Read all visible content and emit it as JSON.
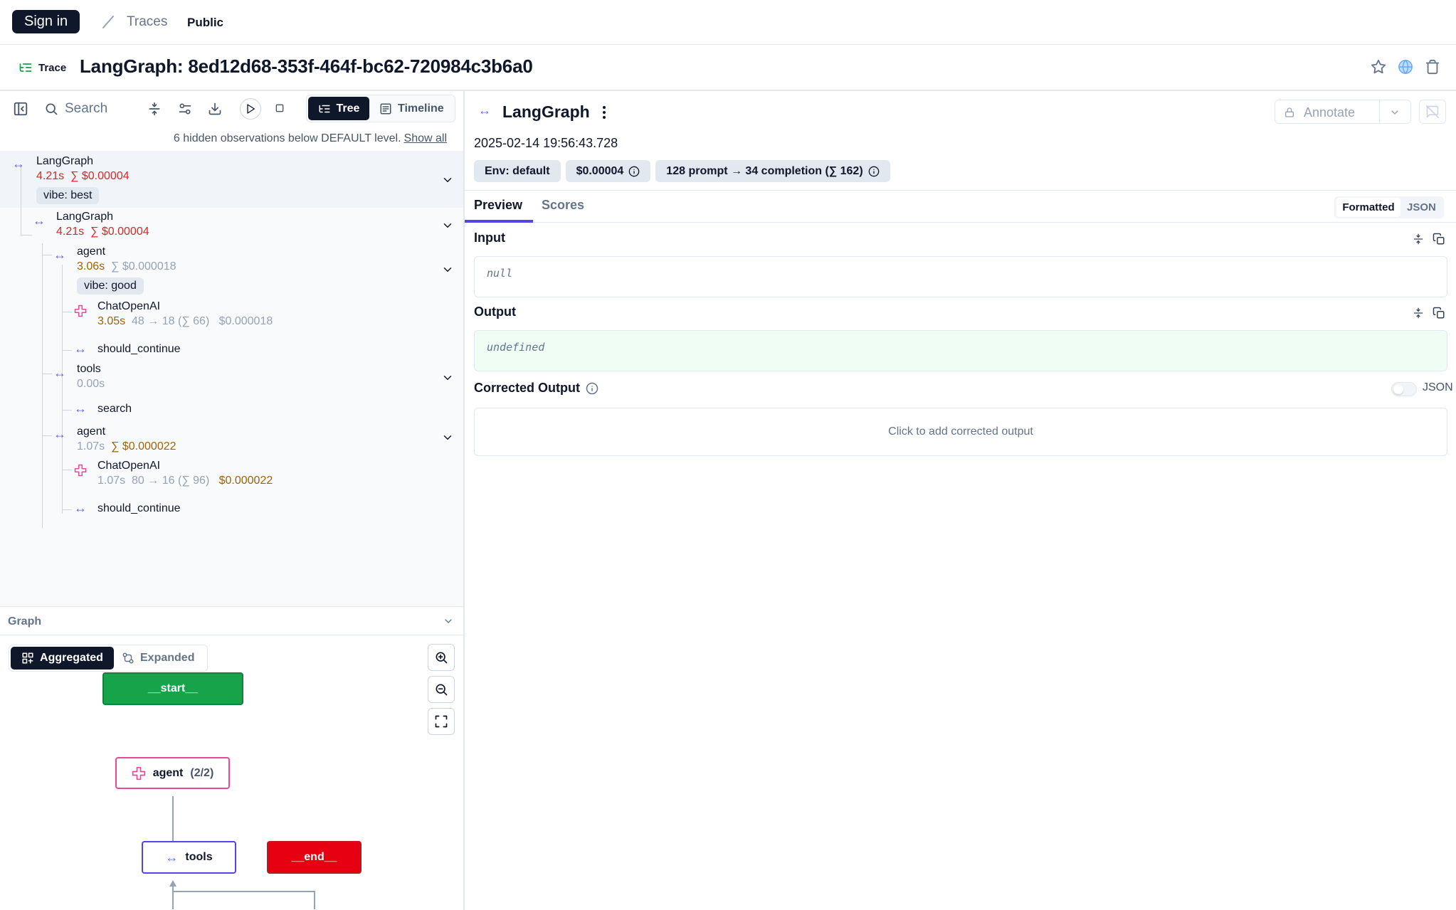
{
  "nav": {
    "signin": "Sign in",
    "traces": "Traces",
    "public": "Public"
  },
  "header": {
    "badge": "Trace",
    "title": "LangGraph: 8ed12d68-353f-464f-bc62-720984c3b6a0"
  },
  "left_toolbar": {
    "search_placeholder": "Search",
    "tree_label": "Tree",
    "timeline_label": "Timeline"
  },
  "hidden_note": {
    "text": "6 hidden observations below DEFAULT level.",
    "link": "Show all"
  },
  "tree": {
    "root": {
      "name": "LangGraph",
      "duration": "4.21s",
      "cost": "∑ $0.00004",
      "tag": "vibe: best"
    },
    "lg": {
      "name": "LangGraph",
      "duration": "4.21s",
      "cost": "∑ $0.00004"
    },
    "agent1": {
      "name": "agent",
      "duration": "3.06s",
      "cost": "∑ $0.000018",
      "tag": "vibe: good"
    },
    "chat1": {
      "name": "ChatOpenAI",
      "duration": "3.05s",
      "tokens": "48 → 18 (∑ 66)",
      "cost": "$0.000018"
    },
    "cont1": {
      "name": "should_continue"
    },
    "tools": {
      "name": "tools",
      "duration": "0.00s"
    },
    "search": {
      "name": "search"
    },
    "agent2": {
      "name": "agent",
      "duration": "1.07s",
      "cost": "∑ $0.000022"
    },
    "chat2": {
      "name": "ChatOpenAI",
      "duration": "1.07s",
      "tokens": "80 → 16 (∑ 96)",
      "cost": "$0.000022"
    },
    "cont2": {
      "name": "should_continue"
    }
  },
  "graph": {
    "title": "Graph",
    "aggregated": "Aggregated",
    "expanded": "Expanded",
    "nodes": {
      "start": "__start__",
      "agent": "agent",
      "agent_count": "(2/2)",
      "tools": "tools",
      "end": "__end__"
    },
    "colors": {
      "start": "#16a34a",
      "end": "#dc2626",
      "agent": "#ec4899",
      "tools": "#4f46e5"
    }
  },
  "detail": {
    "title": "LangGraph",
    "annotate": "Annotate",
    "timestamp": "2025-02-14 19:56:43.728",
    "badges": {
      "env": "Env: default",
      "cost": "$0.00004",
      "tokens": "128 prompt → 34 completion (∑ 162)"
    },
    "tabs": {
      "preview": "Preview",
      "scores": "Scores"
    },
    "format": {
      "formatted": "Formatted",
      "json": "JSON"
    },
    "input": {
      "label": "Input",
      "value": "null"
    },
    "output": {
      "label": "Output",
      "value": "undefined"
    },
    "corrected": {
      "label": "Corrected Output",
      "json_toggle": "JSON",
      "placeholder": "Click to add corrected output"
    }
  }
}
